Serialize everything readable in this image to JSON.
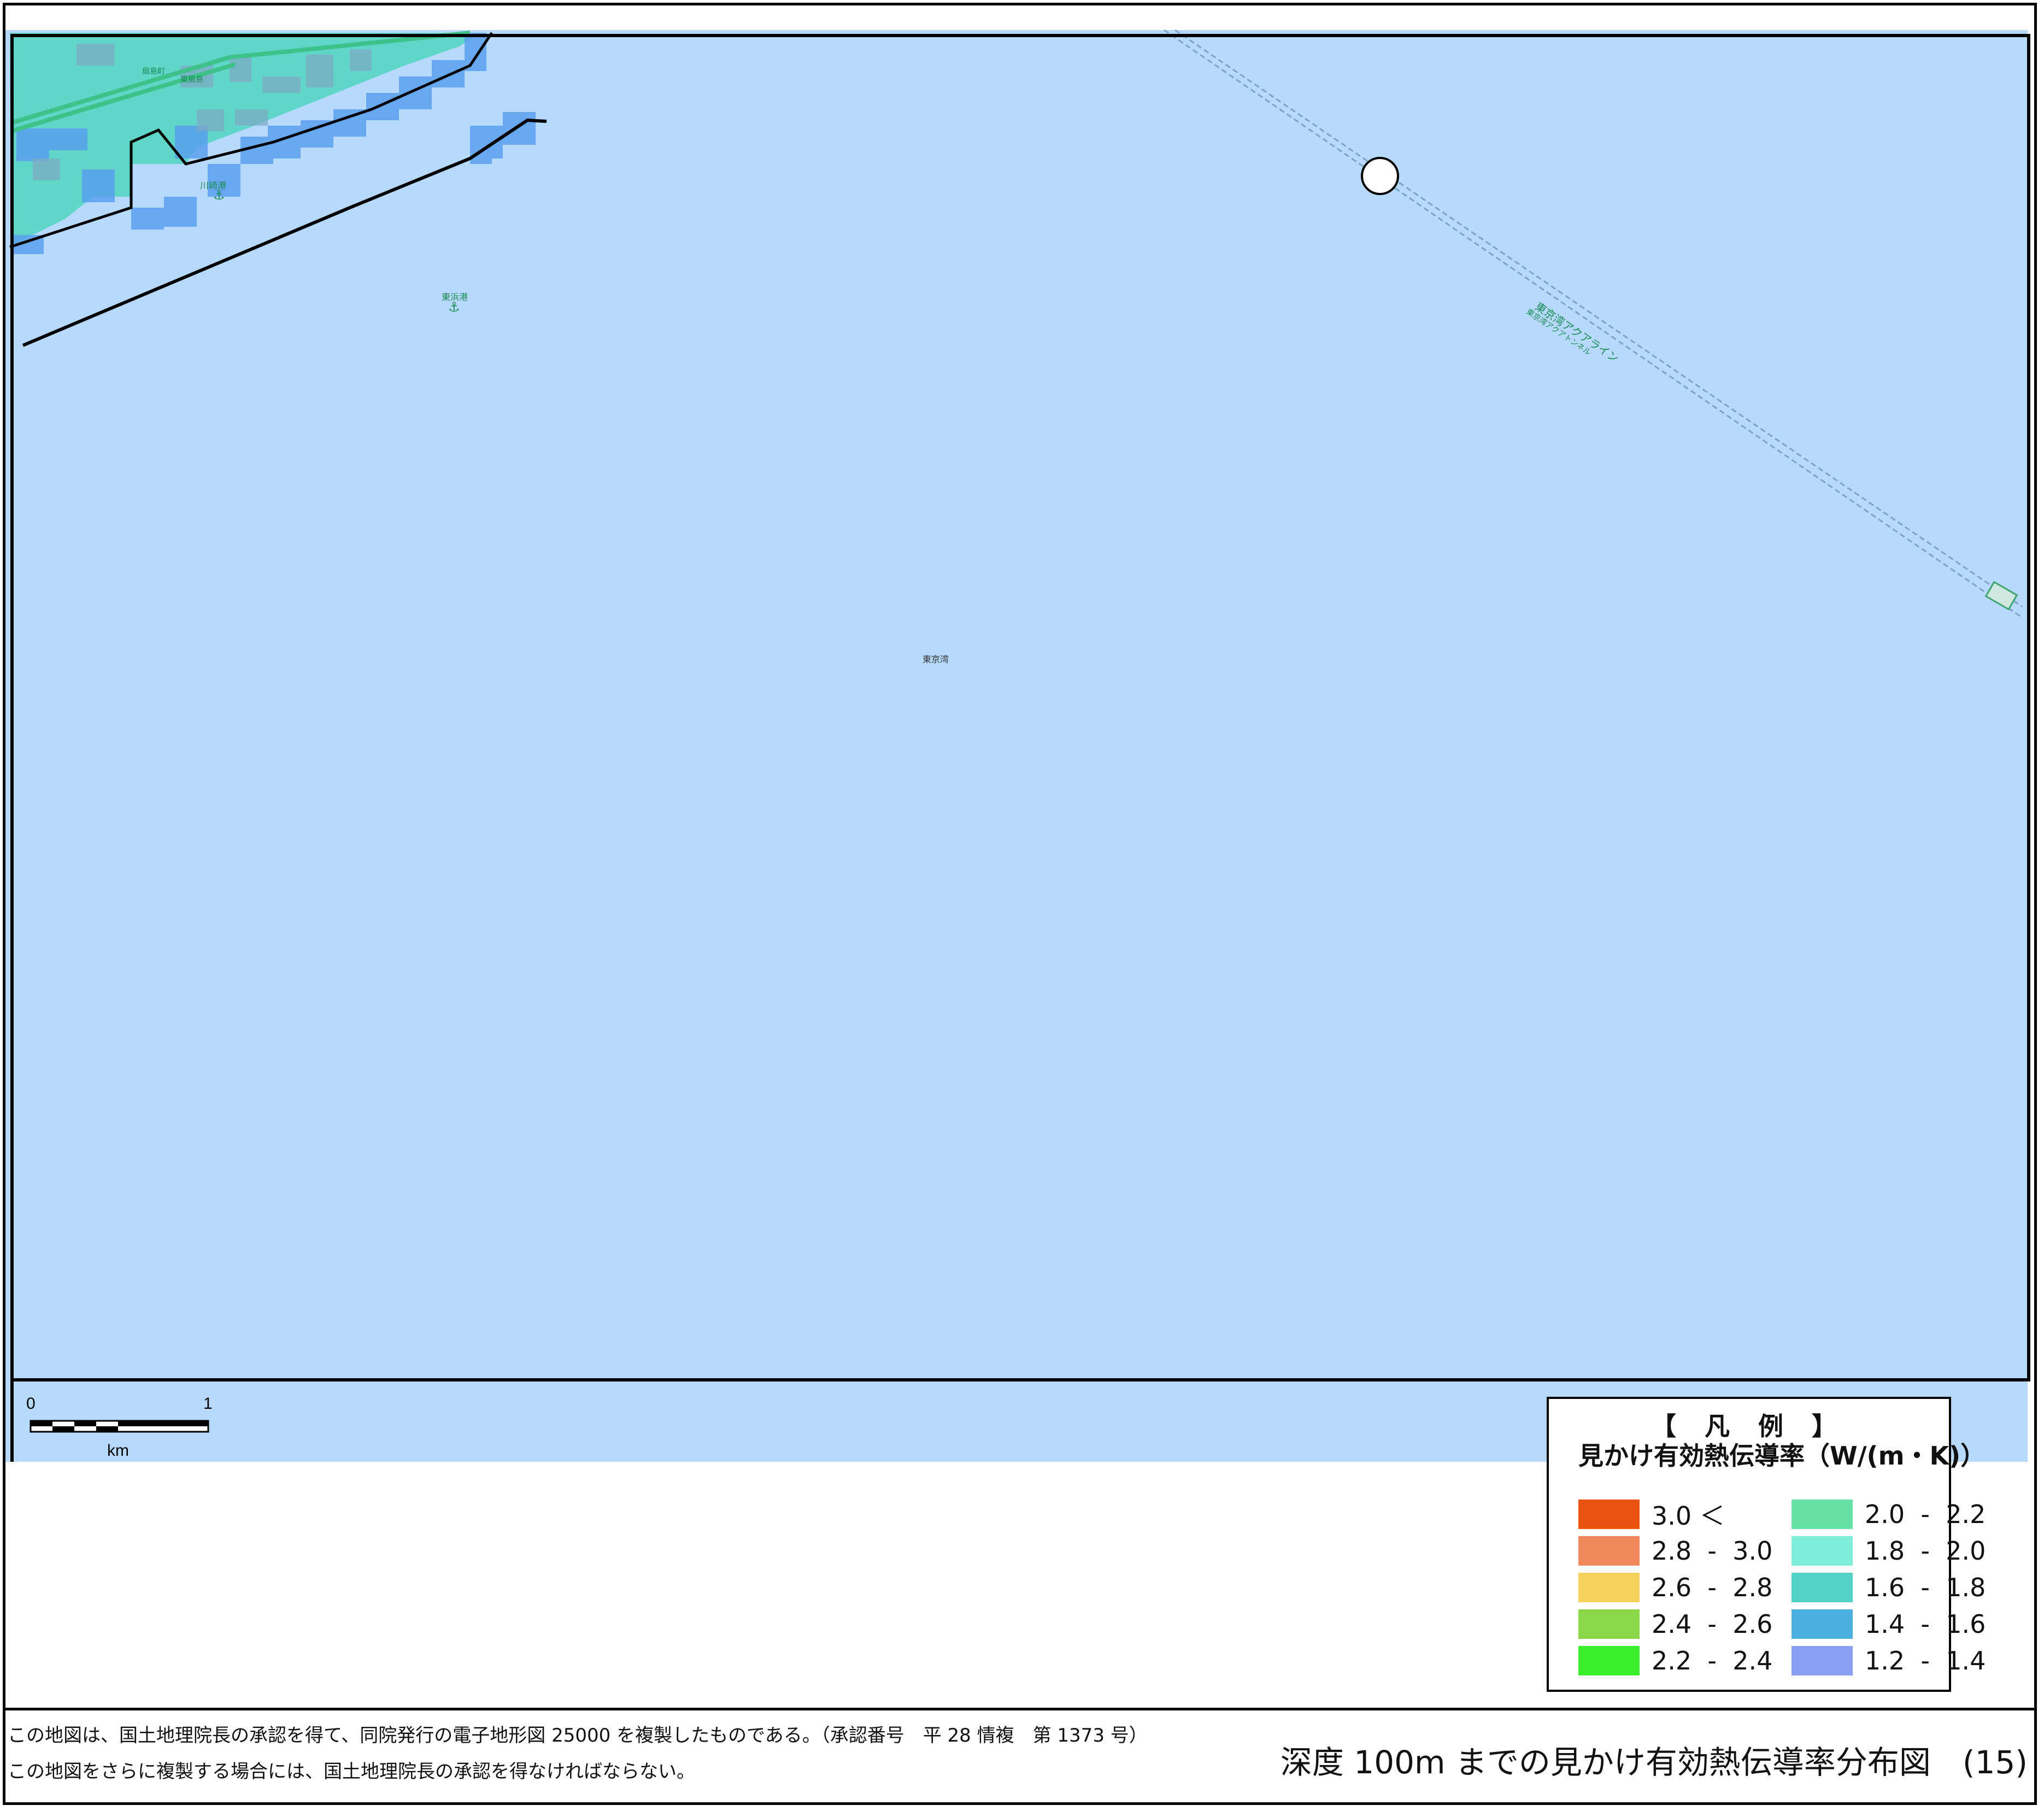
{
  "colors": {
    "sea": "#b7dafc",
    "land_teal": "#5fd6c8",
    "cell_blue": "#5aa0ee",
    "frame": "#000000",
    "road_green": "#3ec28a"
  },
  "map": {
    "labels": {
      "harbor_1": "川崎港",
      "harbor_2": "東浜港",
      "bay": "東京湾",
      "aqualine": "東京湾アクアライン",
      "aqualine_sub": "東京湾アクアトンネル",
      "district_1": "東扇島",
      "district_2": "扇島町"
    },
    "icons": [
      "anchor-icon",
      "anchor-icon",
      "interchange-marker-icon",
      "ship-icon"
    ]
  },
  "scale_bar": {
    "zero": "0",
    "one": "1",
    "unit": "km"
  },
  "legend": {
    "heading": "【 凡 例 】",
    "subtitle": "見かけ有効熱伝導率（W/(m・K)）",
    "items": [
      {
        "label": "3.0 ＜",
        "color": "#e8530f"
      },
      {
        "label": "2.8  -  3.0",
        "color": "#f0875a"
      },
      {
        "label": "2.6  -  2.8",
        "color": "#f5d15a"
      },
      {
        "label": "2.4  -  2.6",
        "color": "#8cd64a"
      },
      {
        "label": "2.2  -  2.4",
        "color": "#3cef2a"
      },
      {
        "label": "2.0  -  2.2",
        "color": "#66e3a4"
      },
      {
        "label": "1.8  -  2.0",
        "color": "#7eeed8"
      },
      {
        "label": "1.6  -  1.8",
        "color": "#52d2c7"
      },
      {
        "label": "1.4  -  1.6",
        "color": "#4eb0de"
      },
      {
        "label": "1.2  -  1.4",
        "color": "#8a9ff0"
      }
    ]
  },
  "footer": {
    "line1": "この地図は、国土地理院長の承認を得て、同院発行の電子地形図 25000 を複製したものである。（承認番号　平 28 情複　第 1373 号）",
    "line2": "この地図をさらに複製する場合には、国土地理院長の承認を得なければならない。",
    "title": "深度 100m までの見かけ有効熱伝導率分布図　(15)"
  }
}
